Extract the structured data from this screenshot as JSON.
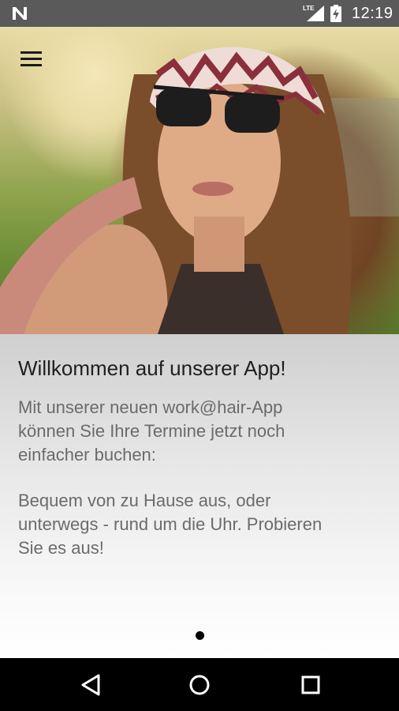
{
  "status_bar": {
    "carrier_icon": "n-logo-icon",
    "network_label": "LTE",
    "signal_icon": "signal-icon",
    "battery_icon": "battery-charging-icon",
    "time": "12:19"
  },
  "header": {
    "menu_icon": "hamburger-menu-icon"
  },
  "hero": {
    "image": "woman-with-sunglasses-and-headscarf-photo"
  },
  "intro": {
    "title": "Willkommen auf unserer App!",
    "paragraph1": "Mit unserer neuen work@hair-App\nkönnen Sie Ihre Termine jetzt noch\neinfacher buchen:",
    "paragraph2": "Bequem von zu Hause aus, oder\nunterwegs - rund um die Uhr. Probieren\nSie es aus!",
    "page_indicator": {
      "current": 1,
      "total": 1
    }
  },
  "nav_bar": {
    "back_icon": "back-triangle-icon",
    "home_icon": "home-circle-icon",
    "recents_icon": "recents-square-icon"
  },
  "colors": {
    "status_bar": "#5a5a5a",
    "title_text": "#1f1f1f",
    "body_text": "#6b6b6b"
  }
}
